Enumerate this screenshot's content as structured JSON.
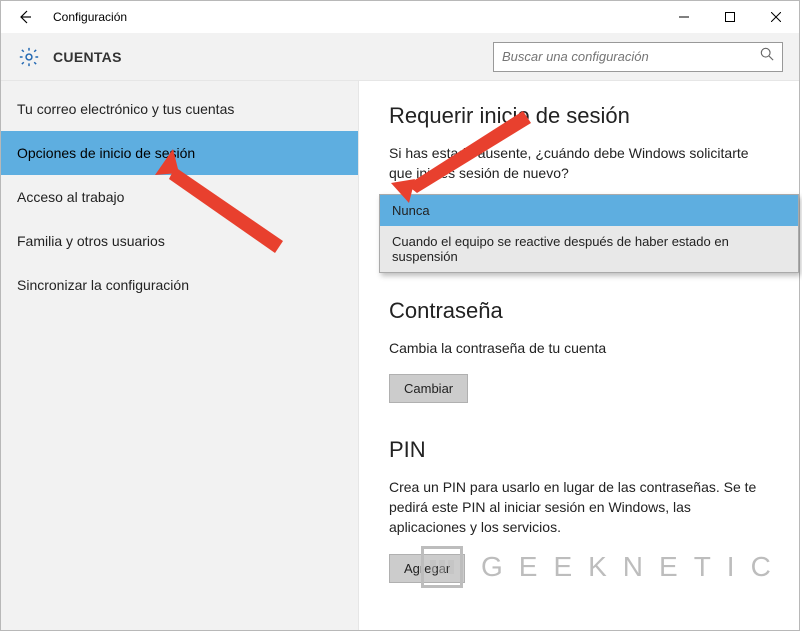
{
  "window": {
    "title": "Configuración"
  },
  "header": {
    "title": "CUENTAS",
    "search_placeholder": "Buscar una configuración"
  },
  "sidebar": {
    "items": [
      {
        "label": "Tu correo electrónico y tus cuentas",
        "selected": false
      },
      {
        "label": "Opciones de inicio de sesión",
        "selected": true
      },
      {
        "label": "Acceso al trabajo",
        "selected": false
      },
      {
        "label": "Familia y otros usuarios",
        "selected": false
      },
      {
        "label": "Sincronizar la configuración",
        "selected": false
      }
    ]
  },
  "content": {
    "require_signin": {
      "title": "Requerir inicio de sesión",
      "desc": "Si has estado ausente, ¿cuándo debe Windows solicitarte que inicies sesión de nuevo?"
    },
    "dropdown": {
      "options": [
        "Nunca",
        "Cuando el equipo se reactive después de haber estado en suspensión"
      ],
      "selected_index": 0
    },
    "password": {
      "title": "Contraseña",
      "desc": "Cambia la contraseña de tu cuenta",
      "button": "Cambiar"
    },
    "pin": {
      "title": "PIN",
      "desc": "Crea un PIN para usarlo en lugar de las contraseñas. Se te pedirá este PIN al iniciar sesión en Windows, las aplicaciones y los servicios.",
      "button": "Agregar"
    }
  },
  "watermark": "GEEKNETIC"
}
